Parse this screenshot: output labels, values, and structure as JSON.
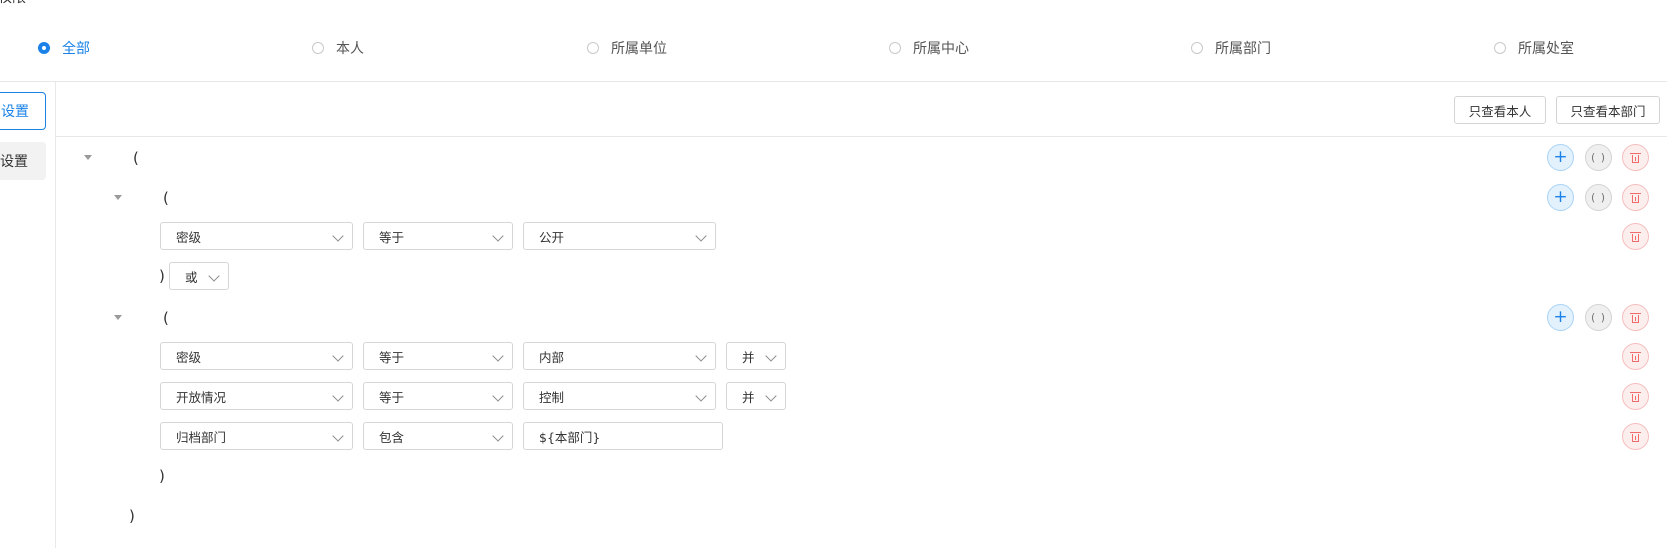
{
  "header": {
    "clipped_text": "权限"
  },
  "scope": {
    "options": [
      {
        "label": "全部",
        "checked": true
      },
      {
        "label": "本人",
        "checked": false
      },
      {
        "label": "所属单位",
        "checked": false
      },
      {
        "label": "所属中心",
        "checked": false
      },
      {
        "label": "所属部门",
        "checked": false
      },
      {
        "label": "所属处室",
        "checked": false
      }
    ]
  },
  "side_tabs": [
    {
      "label": "设置",
      "active": true
    },
    {
      "label": "设置",
      "active": false
    }
  ],
  "toolbar": {
    "self_only_label": "只查看本人",
    "dept_only_label": "只查看本部门"
  },
  "tree": {
    "root_open": "(",
    "root_close": ")",
    "group1": {
      "open": "(",
      "close": ")",
      "row1": {
        "field": "密级",
        "operator": "等于",
        "value": "公开"
      },
      "connector": "或"
    },
    "group2": {
      "open": "(",
      "close": ")",
      "row1": {
        "field": "密级",
        "operator": "等于",
        "value": "内部",
        "logic": "并"
      },
      "row2": {
        "field": "开放情况",
        "operator": "等于",
        "value": "控制",
        "logic": "并"
      },
      "row3": {
        "field": "归档部门",
        "operator": "包含",
        "value": "${本部门}"
      }
    }
  },
  "buttons": {
    "add": "+",
    "group": "( )"
  },
  "colors": {
    "accent": "#1b82e7",
    "danger": "#f06b6b",
    "border": "#d6d6d6"
  }
}
